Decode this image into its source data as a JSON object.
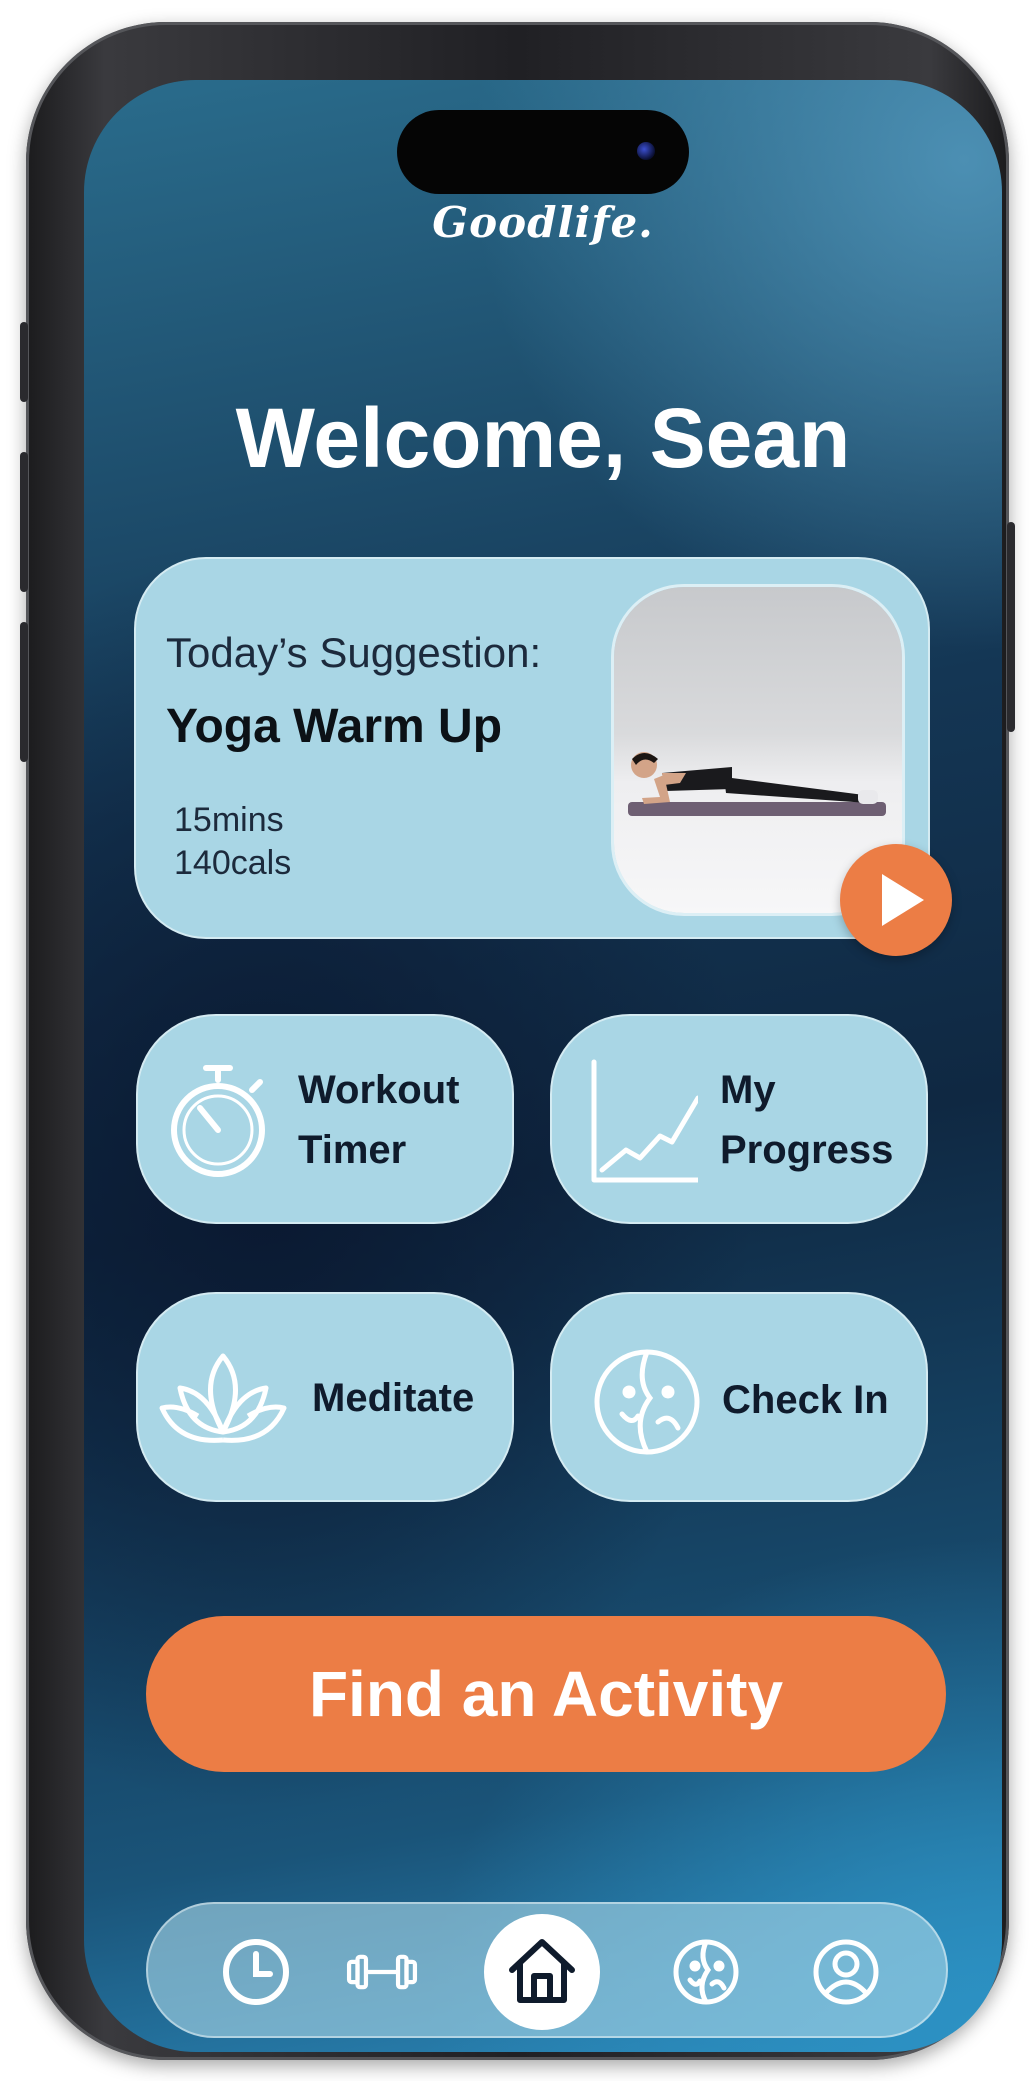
{
  "app": {
    "logo": "Goodlife."
  },
  "welcome": "Welcome, Sean",
  "suggestion": {
    "label": "Today’s Suggestion:",
    "title": "Yoga Warm Up",
    "duration": "15mins",
    "calories": "140cals"
  },
  "tiles": [
    {
      "line1": "Workout",
      "line2": "Timer",
      "icon": "stopwatch-icon"
    },
    {
      "line1": "My",
      "line2": "Progress",
      "icon": "line-chart-icon"
    },
    {
      "label": "Meditate",
      "icon": "lotus-icon"
    },
    {
      "label": "Check In",
      "icon": "mood-face-icon"
    }
  ],
  "cta": "Find an Activity",
  "nav": [
    "clock-icon",
    "dumbbell-icon",
    "home-icon",
    "mood-face-icon",
    "profile-icon"
  ],
  "colors": {
    "accent": "#ec7d45",
    "card": "#a9d6e5",
    "text_dark": "#0f1b2c"
  }
}
